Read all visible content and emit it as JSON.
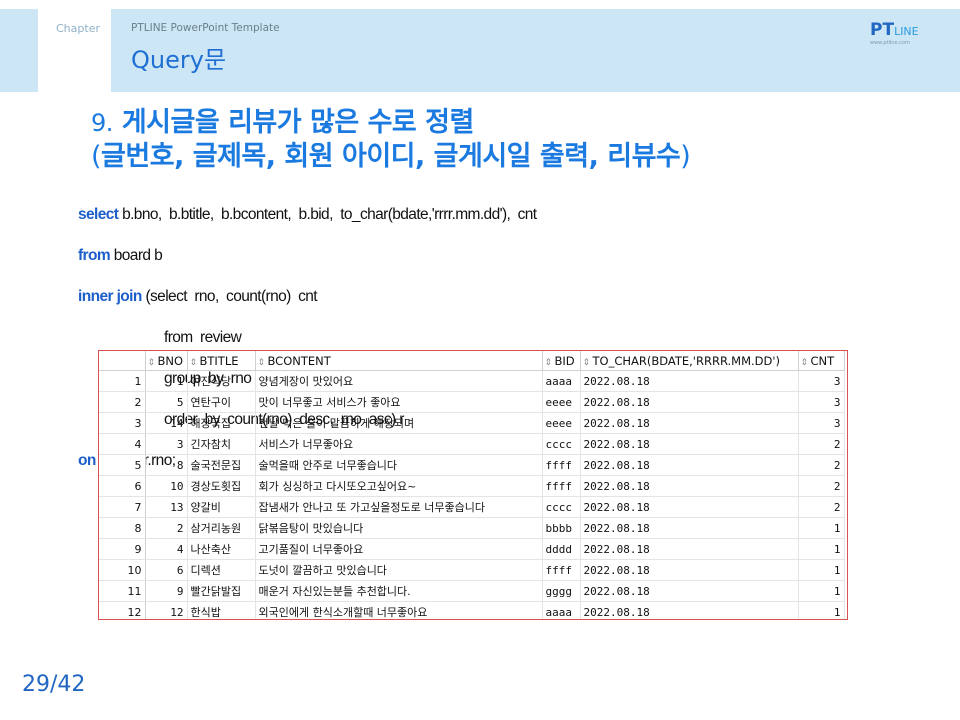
{
  "header": {
    "chapter": "Chapter",
    "template": "PTLINE PowerPoint Template",
    "title": "Query문",
    "logo_main": "PT",
    "logo_small": "LINE",
    "logo_url": "www.ptline.com"
  },
  "heading": {
    "number": "9.",
    "line1": "게시글을 리뷰가 많은 수로 정렬",
    "line2_open": "(",
    "line2": "글번호, 글제목, 회원 아이디, 글게시일 출력, 리뷰수",
    "line2_close": ")"
  },
  "sql": {
    "l1_kw": "select",
    "l1": " b.bno,  b.btitle,  b.bcontent,  b.bid,  to_char(bdate,'rrrr.mm.dd'),  cnt",
    "l2_kw": "from",
    "l2": " board b",
    "l3_kw": "inner join",
    "l3": " (select  rno,  count(rno)  cnt",
    "l4": "from  review",
    "l5": "group  by  rno",
    "l6": "order  by  count(rno)  desc,  rno  asc) r",
    "l7_kw": "on",
    "l7": " b.bno=r.rno;"
  },
  "table": {
    "columns": [
      "BNO",
      "BTITLE",
      "BCONTENT",
      "BID",
      "TO_CHAR(BDATE,'RRRR.MM.DD')",
      "CNT"
    ],
    "rows": [
      [
        "1",
        "1",
        "여진식당",
        "양념게장이 맛있어요",
        "aaaa",
        "2022.08.18",
        "3"
      ],
      [
        "2",
        "5",
        "연탄구이",
        "맛이 너무좋고 서비스가 좋아요",
        "eeee",
        "2022.08.18",
        "3"
      ],
      [
        "3",
        "14",
        "해장국집",
        "전날 먹은 술이 말끔하게 해장되며",
        "eeee",
        "2022.08.18",
        "3"
      ],
      [
        "4",
        "3",
        "긴자참치",
        "서비스가 너무좋아요",
        "cccc",
        "2022.08.18",
        "2"
      ],
      [
        "5",
        "8",
        "술국전문집",
        "술먹을때 안주로 너무좋습니다",
        "ffff",
        "2022.08.18",
        "2"
      ],
      [
        "6",
        "10",
        "경상도횟집",
        "회가 싱싱하고 다시또오고싶어요~",
        "ffff",
        "2022.08.18",
        "2"
      ],
      [
        "7",
        "13",
        "양갈비",
        "잡냄새가 안나고 또 가고싶을정도로 너무좋습니다",
        "cccc",
        "2022.08.18",
        "2"
      ],
      [
        "8",
        "2",
        "삼거리농원",
        "닭볶음탕이 맛있습니다",
        "bbbb",
        "2022.08.18",
        "1"
      ],
      [
        "9",
        "4",
        "나산축산",
        "고기품질이 너무좋아요",
        "dddd",
        "2022.08.18",
        "1"
      ],
      [
        "10",
        "6",
        "디렉션",
        "도넛이 깔끔하고 맛있습니다",
        "ffff",
        "2022.08.18",
        "1"
      ],
      [
        "11",
        "9",
        "빨간닭발집",
        "매운거 자신있는분들 추천합니다.",
        "gggg",
        "2022.08.18",
        "1"
      ],
      [
        "12",
        "12",
        "한식밥",
        "외국인에게 한식소개할때 너무좋아요",
        "aaaa",
        "2022.08.18",
        "1"
      ]
    ]
  },
  "footer": {
    "page_number": "29/42"
  },
  "colors": {
    "accent": "#1b7ae0",
    "header_band": "#cde6f5",
    "table_border": "#d95050"
  }
}
